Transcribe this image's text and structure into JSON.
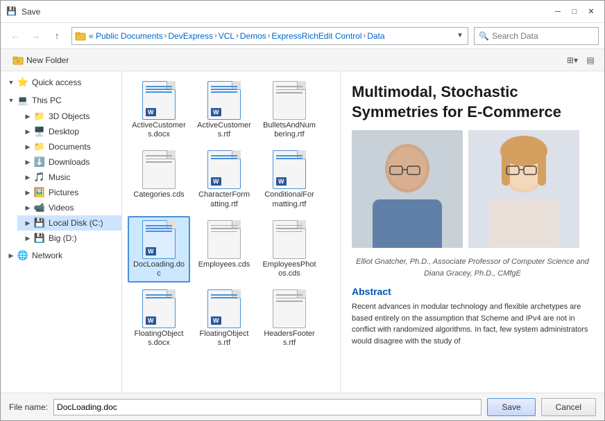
{
  "window": {
    "title": "Save",
    "title_icon": "💾",
    "close_btn": "✕",
    "minimize_btn": "─",
    "maximize_btn": "□"
  },
  "toolbar": {
    "back_title": "Back",
    "forward_title": "Forward",
    "up_title": "Up",
    "new_folder_label": "New Folder",
    "search_placeholder": "Search Data",
    "breadcrumbs": [
      "« Public Documents",
      "DevExpress",
      "VCL",
      "Demos",
      "ExpressRichEdit Control",
      "Data"
    ]
  },
  "sidebar": {
    "quick_access_label": "Quick access",
    "this_pc_label": "This PC",
    "objects_3d_label": "3D Objects",
    "desktop_label": "Desktop",
    "documents_label": "Documents",
    "downloads_label": "Downloads",
    "music_label": "Music",
    "pictures_label": "Pictures",
    "videos_label": "Videos",
    "local_disk_label": "Local Disk (C:)",
    "big_d_label": "Big (D:)",
    "network_label": "Network"
  },
  "files": [
    {
      "name": "ActiveCustomers.docx",
      "type": "word"
    },
    {
      "name": "ActiveCustomers.rtf",
      "type": "word"
    },
    {
      "name": "BulletsAndNumbering.rtf",
      "type": "plain"
    },
    {
      "name": "Categories.cds",
      "type": "plain"
    },
    {
      "name": "CharacterFormatting.rtf",
      "type": "plain"
    },
    {
      "name": "ConditionalFormatting.rtf",
      "type": "plain"
    },
    {
      "name": "DocLoading.doc",
      "type": "word",
      "selected": true
    },
    {
      "name": "Employees.cds",
      "type": "plain"
    },
    {
      "name": "EmployeesPhotos.cds",
      "type": "plain"
    },
    {
      "name": "FloatingObjects.docx",
      "type": "word"
    },
    {
      "name": "FloatingObjects.rtf",
      "type": "word"
    },
    {
      "name": "HeadersFooters.rtf",
      "type": "plain"
    }
  ],
  "preview": {
    "title": "Multimodal, Stochastic Symmetries for E-Commerce",
    "authors": "Elliot Gnatcher, Ph.D., Associate Professor of\nComputer Science\nand Diana Gracey, Ph.D., CMfgE",
    "abstract_title": "Abstract",
    "abstract_text": "Recent advances in modular technology and flexible archetypes are based entirely on the assumption that Scheme and IPv4 are not in conflict with randomized algorithms. In fact, few system administrators would disagree with the study of"
  },
  "footer": {
    "label": "File name:",
    "value": "DocLoading.doc",
    "save_label": "Save",
    "cancel_label": "Cancel"
  }
}
